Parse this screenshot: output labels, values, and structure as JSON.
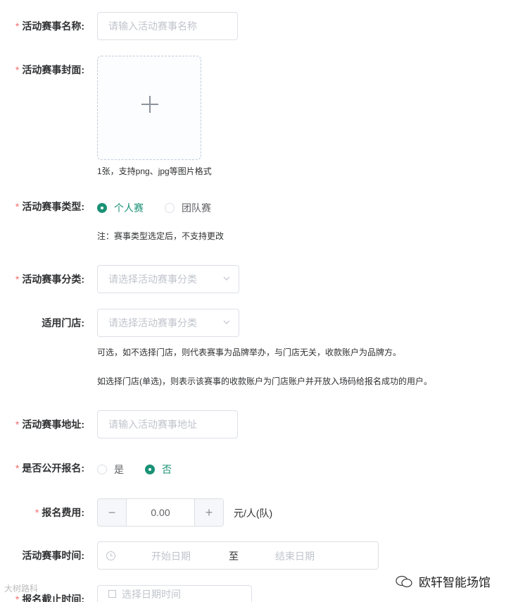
{
  "form": {
    "name": {
      "required": "*",
      "label": "活动赛事名称:",
      "placeholder": "请输入活动赛事名称"
    },
    "cover": {
      "required": "*",
      "label": "活动赛事封面:",
      "hint": "1张，支持png、jpg等图片格式"
    },
    "type": {
      "required": "*",
      "label": "活动赛事类型:",
      "options": [
        "个人赛",
        "团队赛"
      ],
      "selected": "个人赛",
      "note": "注：赛事类型选定后，不支持更改"
    },
    "category": {
      "required": "*",
      "label": "活动赛事分类:",
      "placeholder": "请选择活动赛事分类"
    },
    "store": {
      "label": "适用门店:",
      "placeholder": "请选择活动赛事分类",
      "note1": "可选，如不选择门店，则代表赛事为品牌举办，与门店无关，收款账户为品牌方。",
      "note2": "如选择门店(单选)，则表示该赛事的收款账户为门店账户并开放入场码给报名成功的用户。"
    },
    "address": {
      "required": "*",
      "label": "活动赛事地址:",
      "placeholder": "请输入活动赛事地址"
    },
    "public": {
      "required": "*",
      "label": "是否公开报名:",
      "options": [
        "是",
        "否"
      ],
      "selected": "否"
    },
    "fee": {
      "required": "*",
      "label": "报名费用:",
      "value": "0.00",
      "minus": "−",
      "plus": "+",
      "unit": "元/人(队)"
    },
    "time": {
      "label": "活动赛事时间:",
      "start_placeholder": "开始日期",
      "separator": "至",
      "end_placeholder": "结束日期"
    },
    "deadline": {
      "required": "*",
      "label": "报名截止时间:",
      "placeholder": "选择日期时间"
    }
  },
  "watermark": {
    "text": "欧轩智能场馆",
    "left_text": "大树路科"
  },
  "colors": {
    "accent": "#1a9276",
    "required": "#f56c6c",
    "border": "#dcdfe6",
    "placeholder": "#c0c4cc"
  }
}
